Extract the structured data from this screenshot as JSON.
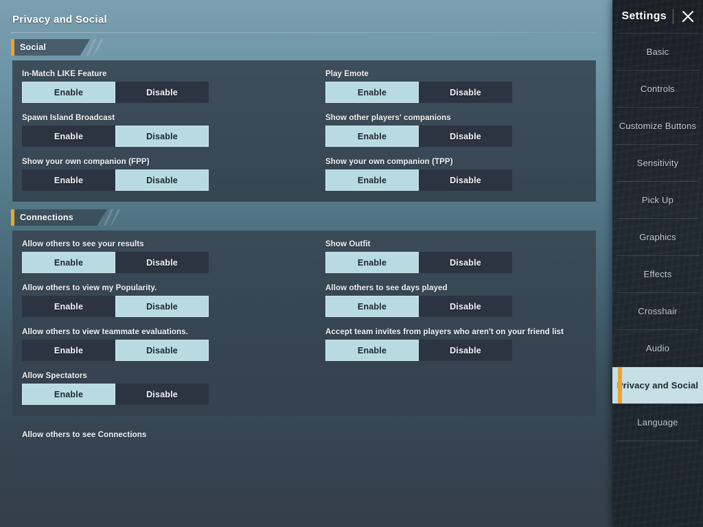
{
  "page": {
    "title": "Privacy and Social"
  },
  "sidebar": {
    "title": "Settings",
    "close_icon": "close-icon",
    "items": [
      {
        "label": "Basic",
        "active": false
      },
      {
        "label": "Controls",
        "active": false
      },
      {
        "label": "Customize Buttons",
        "active": false
      },
      {
        "label": "Sensitivity",
        "active": false
      },
      {
        "label": "Pick Up",
        "active": false
      },
      {
        "label": "Graphics",
        "active": false
      },
      {
        "label": "Effects",
        "active": false
      },
      {
        "label": "Crosshair",
        "active": false
      },
      {
        "label": "Audio",
        "active": false
      },
      {
        "label": "Privacy and Social",
        "active": true
      },
      {
        "label": "Language",
        "active": false
      }
    ]
  },
  "toggle_labels": {
    "enable": "Enable",
    "disable": "Disable"
  },
  "colors": {
    "accent_orange": "#f0a32a",
    "active_toggle": "#b8dbe2",
    "inactive_toggle": "#2b3440",
    "card_background": "#38464f",
    "sidebar_background": "#1e262e"
  },
  "sections": [
    {
      "title": "Social",
      "options": [
        {
          "label": "In-Match LIKE Feature",
          "value": "Enable",
          "column": "left"
        },
        {
          "label": "Play Emote",
          "value": "Enable",
          "column": "right"
        },
        {
          "label": "Spawn Island Broadcast",
          "value": "Disable",
          "column": "left"
        },
        {
          "label": "Show other players' companions",
          "value": "Enable",
          "column": "right"
        },
        {
          "label": "Show your own companion (FPP)",
          "value": "Disable",
          "column": "left"
        },
        {
          "label": "Show your own companion (TPP)",
          "value": "Enable",
          "column": "right"
        }
      ]
    },
    {
      "title": "Connections",
      "options": [
        {
          "label": "Allow others to see your results",
          "value": "Enable",
          "column": "left"
        },
        {
          "label": "Show Outfit",
          "value": "Enable",
          "column": "right"
        },
        {
          "label": "Allow others to view my Popularity.",
          "value": "Disable",
          "column": "left"
        },
        {
          "label": "Allow others to see days played",
          "value": "Enable",
          "column": "right"
        },
        {
          "label": "Allow others to view teammate evaluations.",
          "value": "Disable",
          "column": "left"
        },
        {
          "label": "Accept team invites from players who aren't on your friend list",
          "value": "Enable",
          "column": "right"
        },
        {
          "label": "Allow Spectators",
          "value": "Enable",
          "column": "left"
        }
      ]
    }
  ],
  "partial_section": {
    "label": "Allow others to see Connections"
  }
}
